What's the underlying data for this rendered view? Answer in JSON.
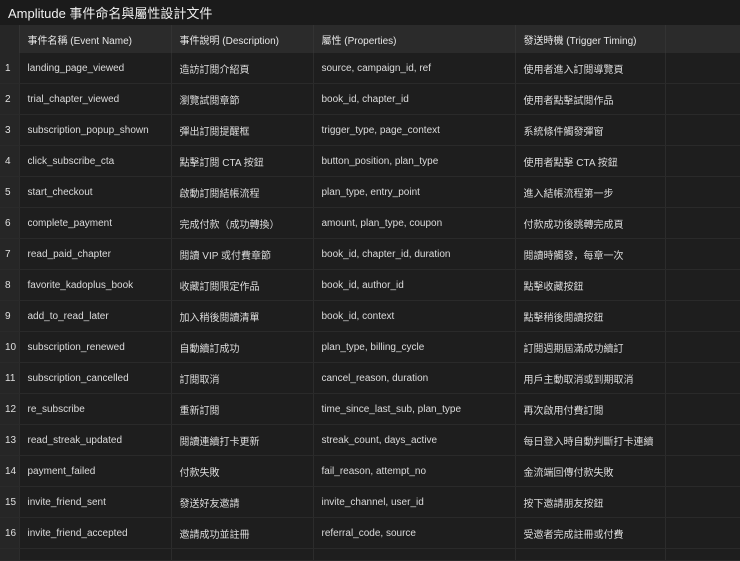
{
  "title": "Amplitude 事件命名與屬性設計文件",
  "headers": [
    "事件名稱 (Event Name)",
    "事件說明 (Description)",
    "屬性 (Properties)",
    "發送時機 (Trigger Timing)"
  ],
  "rows": [
    {
      "n": "1",
      "name": "landing_page_viewed",
      "desc": "造訪訂閱介紹頁",
      "props": "source, campaign_id, ref",
      "trigger": "使用者進入訂閱導覽頁"
    },
    {
      "n": "2",
      "name": "trial_chapter_viewed",
      "desc": "瀏覽試閱章節",
      "props": "book_id, chapter_id",
      "trigger": "使用者點擊試閱作品"
    },
    {
      "n": "3",
      "name": "subscription_popup_shown",
      "desc": "彈出訂閱提醒框",
      "props": "trigger_type, page_context",
      "trigger": "系統條件觸發彈窗"
    },
    {
      "n": "4",
      "name": "click_subscribe_cta",
      "desc": "點擊訂閱 CTA 按鈕",
      "props": "button_position, plan_type",
      "trigger": "使用者點擊 CTA 按鈕"
    },
    {
      "n": "5",
      "name": "start_checkout",
      "desc": "啟動訂閱結帳流程",
      "props": "plan_type, entry_point",
      "trigger": "進入結帳流程第一步"
    },
    {
      "n": "6",
      "name": "complete_payment",
      "desc": "完成付款（成功轉換）",
      "props": "amount, plan_type, coupon",
      "trigger": "付款成功後跳轉完成頁"
    },
    {
      "n": "7",
      "name": "read_paid_chapter",
      "desc": "閱讀 VIP 或付費章節",
      "props": "book_id, chapter_id, duration",
      "trigger": "閱讀時觸發，每章一次"
    },
    {
      "n": "8",
      "name": "favorite_kadoplus_book",
      "desc": "收藏訂閱限定作品",
      "props": "book_id, author_id",
      "trigger": "點擊收藏按鈕"
    },
    {
      "n": "9",
      "name": "add_to_read_later",
      "desc": "加入稍後閱讀清單",
      "props": "book_id, context",
      "trigger": "點擊稍後閱讀按鈕"
    },
    {
      "n": "10",
      "name": "subscription_renewed",
      "desc": "自動續訂成功",
      "props": "plan_type, billing_cycle",
      "trigger": "訂閱週期屆滿成功續訂"
    },
    {
      "n": "11",
      "name": "subscription_cancelled",
      "desc": "訂閱取消",
      "props": "cancel_reason, duration",
      "trigger": "用戶主動取消或到期取消"
    },
    {
      "n": "12",
      "name": "re_subscribe",
      "desc": "重新訂閱",
      "props": "time_since_last_sub, plan_type",
      "trigger": "再次啟用付費訂閱"
    },
    {
      "n": "13",
      "name": "read_streak_updated",
      "desc": "閱讀連續打卡更新",
      "props": "streak_count, days_active",
      "trigger": "每日登入時自動判斷打卡連續"
    },
    {
      "n": "14",
      "name": "payment_failed",
      "desc": "付款失敗",
      "props": "fail_reason, attempt_no",
      "trigger": "金流端回傳付款失敗"
    },
    {
      "n": "15",
      "name": "invite_friend_sent",
      "desc": "發送好友邀請",
      "props": "invite_channel, user_id",
      "trigger": "按下邀請朋友按鈕"
    },
    {
      "n": "16",
      "name": "invite_friend_accepted",
      "desc": "邀請成功並註冊",
      "props": "referral_code, source",
      "trigger": "受邀者完成註冊或付費"
    }
  ]
}
